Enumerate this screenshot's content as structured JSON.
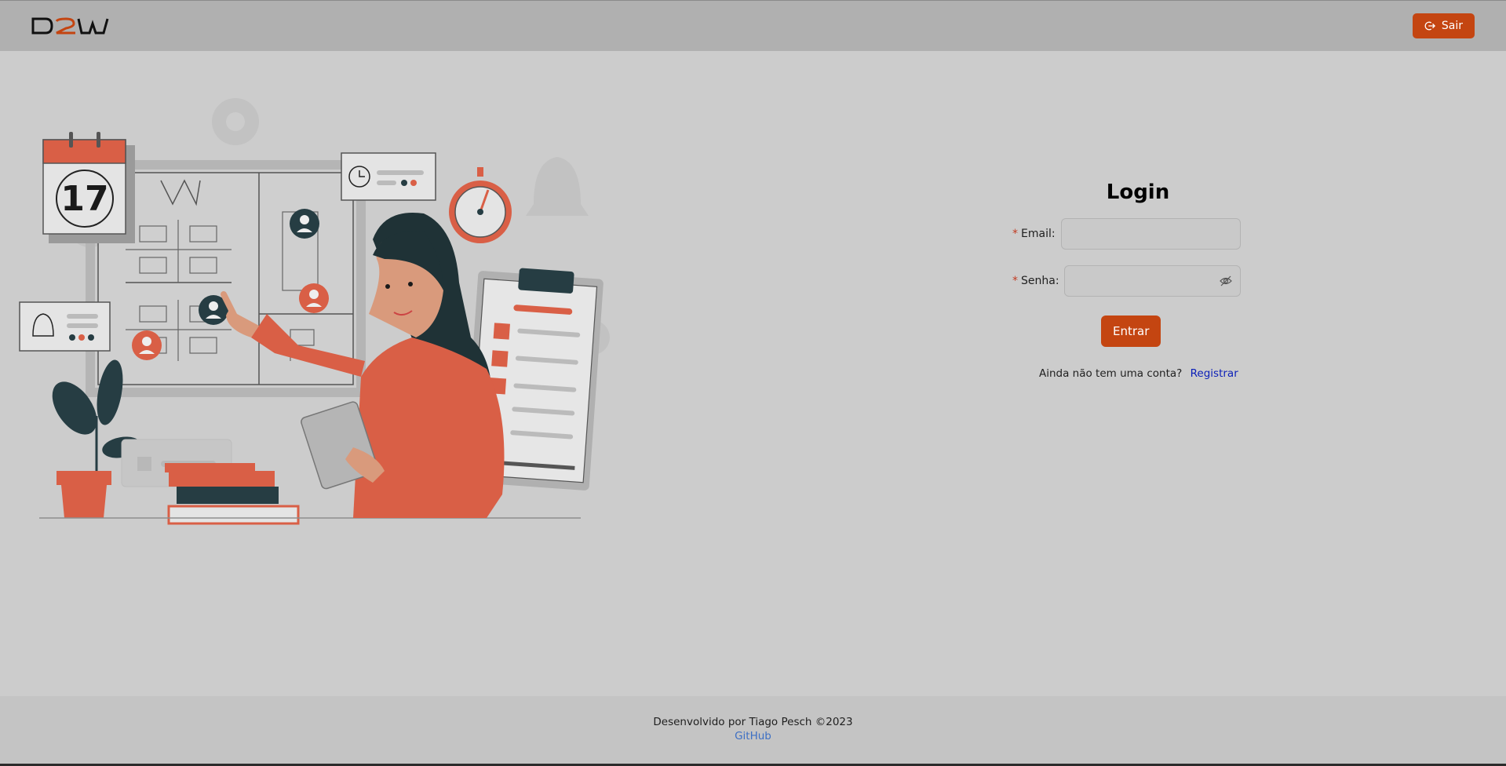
{
  "header": {
    "logo_text": "D2W",
    "logout_label": "Sair",
    "logout_icon": "logout-icon"
  },
  "illustration": {
    "calendar_day": "17"
  },
  "login": {
    "title": "Login",
    "email_label": "Email",
    "email_value": "",
    "password_label": "Senha",
    "password_value": "",
    "required_mark": "*",
    "label_colon": ":",
    "submit_label": "Entrar",
    "register_prompt": "Ainda não tem uma conta?",
    "register_link": "Registrar"
  },
  "footer": {
    "credits": "Desenvolvido por Tiago Pesch ©2023",
    "github_link": "GitHub"
  },
  "colors": {
    "accent": "#c44511",
    "link": "#0b1fb8",
    "illustration_red": "#d95f46",
    "illustration_dark": "#263d43"
  }
}
